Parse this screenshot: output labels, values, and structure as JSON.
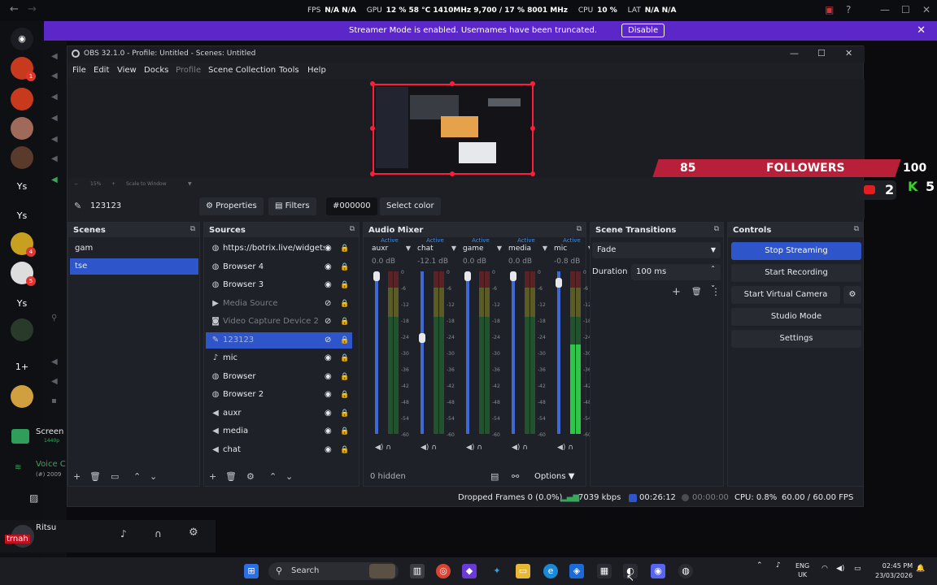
{
  "overlay_stats": {
    "fps_label": "FPS",
    "fps_value": "N/A N/A",
    "gpu_label": "GPU",
    "gpu_value": "12 % 58 °C 1410MHz 9,700 / 17 % 8001 MHz",
    "cpu_label": "CPU",
    "cpu_value": "10 %",
    "lat_label": "LAT",
    "lat_value": "N/A N/A"
  },
  "banner": {
    "text": "Streamer Mode is enabled. Usernames have been truncated.",
    "button": "Disable",
    "close": "✕"
  },
  "discord": {
    "guild_labels": [
      "Ys",
      "Ys",
      "Ys",
      "1+"
    ],
    "screen_share": "Screen",
    "screen_share_sub": "1440p",
    "voice_label": "Voice C",
    "voice_sub": "(#) 2009",
    "user_name": "Ritsu",
    "user_overlay": "trnah"
  },
  "obs": {
    "title": "OBS 32.1.0 - Profile: Untitled - Scenes: Untitled",
    "menu": [
      "File",
      "Edit",
      "View",
      "Docks",
      "Profile",
      "Scene Collection",
      "Tools",
      "Help"
    ],
    "zoom": {
      "percent": "15%",
      "scale_label": "Scale to Window"
    },
    "toolbar": {
      "source_name": "123123",
      "properties": "Properties",
      "filters": "Filters",
      "color_value": "#000000",
      "select_color": "Select color"
    },
    "scenes": {
      "title": "Scenes",
      "items": [
        "gam",
        "tse"
      ],
      "selected": 1
    },
    "sources": {
      "title": "Sources",
      "items": [
        {
          "icon": "globe-icon",
          "name": "https://botrix.live/widgets",
          "state": "normal"
        },
        {
          "icon": "globe-icon",
          "name": "Browser 4",
          "state": "normal"
        },
        {
          "icon": "globe-icon",
          "name": "Browser 3",
          "state": "normal"
        },
        {
          "icon": "play-icon",
          "name": "Media Source",
          "state": "hidden"
        },
        {
          "icon": "camera-icon",
          "name": "Video Capture Device 2",
          "state": "hidden"
        },
        {
          "icon": "brush-icon",
          "name": "123123",
          "state": "selected"
        },
        {
          "icon": "mic-icon",
          "name": "mic",
          "state": "normal"
        },
        {
          "icon": "globe-icon",
          "name": "Browser",
          "state": "normal"
        },
        {
          "icon": "globe-icon",
          "name": "Browser 2",
          "state": "normal"
        },
        {
          "icon": "speaker-icon",
          "name": "auxr",
          "state": "normal"
        },
        {
          "icon": "speaker-icon",
          "name": "media",
          "state": "normal"
        },
        {
          "icon": "speaker-icon",
          "name": "chat",
          "state": "normal"
        }
      ]
    },
    "mixer": {
      "title": "Audio Mixer",
      "active_label": "Active",
      "channels": [
        {
          "name": "auxr",
          "db": "0.0 dB",
          "level": 0.0,
          "volume": 1.0
        },
        {
          "name": "chat",
          "db": "-12.1 dB",
          "level": 0.0,
          "volume": 0.62
        },
        {
          "name": "game",
          "db": "0.0 dB",
          "level": 0.0,
          "volume": 1.0
        },
        {
          "name": "media",
          "db": "0.0 dB",
          "level": 0.0,
          "volume": 1.0
        },
        {
          "name": "mic",
          "db": "-0.8 dB",
          "level": 0.55,
          "volume": 0.96
        }
      ],
      "scale": [
        "0",
        "-6",
        "-12",
        "-18",
        "-24",
        "-30",
        "-36",
        "-42",
        "-48",
        "-54",
        "-60"
      ],
      "hidden": "0 hidden",
      "options": "Options"
    },
    "transitions": {
      "title": "Scene Transitions",
      "selected": "Fade",
      "duration_label": "Duration",
      "duration_value": "100 ms"
    },
    "controls": {
      "title": "Controls",
      "buttons": [
        "Stop Streaming",
        "Start Recording",
        "Start Virtual Camera",
        "Studio Mode",
        "Settings"
      ]
    },
    "status": {
      "dropped": "Dropped Frames 0 (0.0%)",
      "bitrate": "7039 kbps",
      "stream_time": "00:26:12",
      "rec_time": "00:00:00",
      "cpu": "CPU: 0.8%",
      "fps": "60.00 / 60.00 FPS"
    }
  },
  "followers_widget": {
    "count": "85",
    "label": "FOLLOWERS",
    "goal": "100",
    "youtube": "2",
    "kick": "5"
  },
  "taskbar": {
    "search": "Search",
    "lang_top": "ENG",
    "lang_bottom": "UK",
    "time": "02:45 PM",
    "date": "23/03/2026"
  },
  "colors": {
    "accent": "#2e55c9",
    "banner": "#5b27c9",
    "followers_bar": "#b8203a",
    "preview_border": "#ff1d3a"
  }
}
